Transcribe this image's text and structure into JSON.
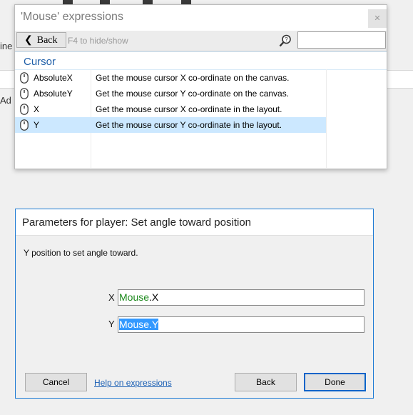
{
  "background": {
    "partial_text_1": "ine",
    "partial_text_2": "Ad"
  },
  "expressions": {
    "title": "'Mouse' expressions",
    "close_glyph": "✕",
    "back_label": "Back",
    "hint": "F4 to hide/show",
    "search_value": "",
    "category": "Cursor",
    "items": [
      {
        "name": "AbsoluteX",
        "description": "Get the mouse cursor X co-ordinate on the canvas."
      },
      {
        "name": "AbsoluteY",
        "description": "Get the mouse cursor Y co-ordinate on the canvas."
      },
      {
        "name": "X",
        "description": "Get the mouse cursor X co-ordinate in the layout."
      },
      {
        "name": "Y",
        "description": "Get the mouse cursor Y co-ordinate in the layout."
      }
    ],
    "selected_item": "Y"
  },
  "dialog": {
    "title": "Parameters for player: Set angle toward position",
    "description": "Y position to set angle toward.",
    "params": [
      {
        "label": "X",
        "object": "Mouse",
        "suffix": ".X"
      },
      {
        "label": "Y",
        "object": "Mouse",
        "suffix": ".Y"
      }
    ],
    "cancel_label": "Cancel",
    "help_label": "Help on expressions",
    "back_label": "Back",
    "done_label": "Done"
  },
  "colors": {
    "accent": "#1e7bd4",
    "selection": "#cce8ff",
    "object_token": "#1e8a1e",
    "category_text": "#1f5fa8"
  }
}
